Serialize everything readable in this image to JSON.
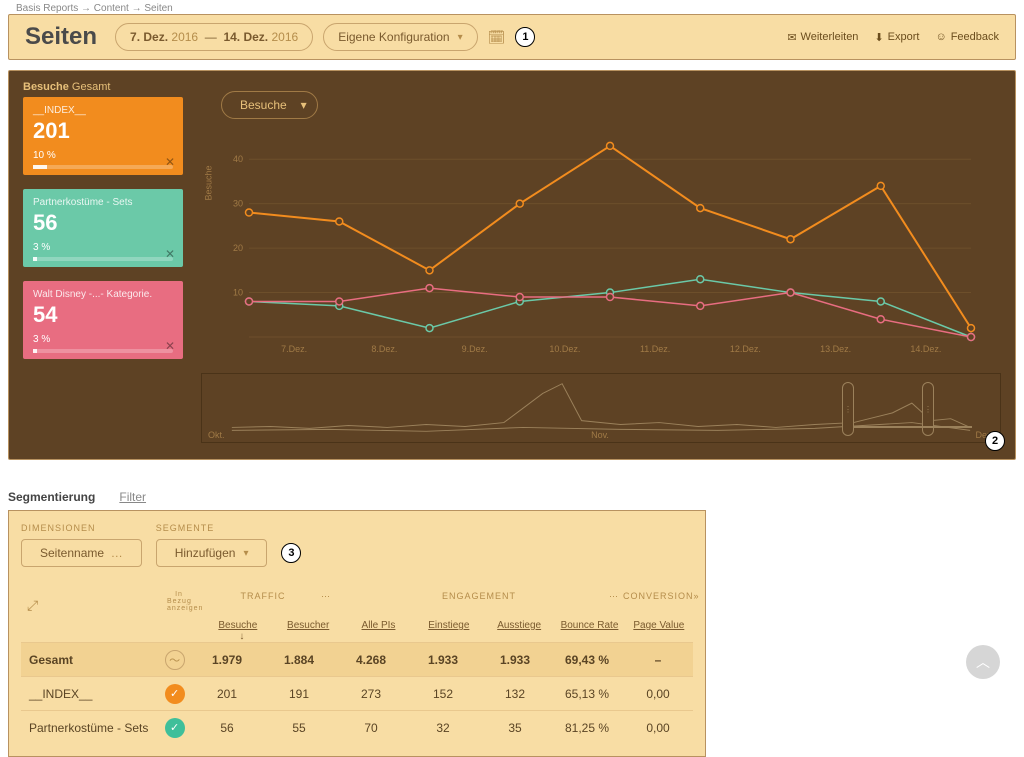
{
  "breadcrumb": "Basis Reports → Content → Seiten",
  "page_title": "Seiten",
  "date_range": {
    "from_day": "7. Dez.",
    "from_year": "2016",
    "sep": "—",
    "to_day": "14. Dez.",
    "to_year": "2016"
  },
  "config_dropdown": "Eigene Konfiguration",
  "annotations": {
    "a1": "1",
    "a2": "2",
    "a3": "3"
  },
  "actions": {
    "forward": "Weiterleiten",
    "export": "Export",
    "feedback": "Feedback"
  },
  "chart": {
    "panel_label_prefix": "Besuche",
    "panel_label_suffix": "Gesamt",
    "metric_dropdown": "Besuche",
    "ylabel": "Besuche",
    "cards": [
      {
        "name": "__INDEX__",
        "value": "201",
        "pct": "10 %",
        "pct_w": "10%",
        "cls": "c-orange"
      },
      {
        "name": "Partnerkostüme - Sets",
        "value": "56",
        "pct": "3 %",
        "pct_w": "3%",
        "cls": "c-teal"
      },
      {
        "name": "Walt Disney -...- Kategorie.",
        "value": "54",
        "pct": "3 %",
        "pct_w": "3%",
        "cls": "c-pink"
      }
    ],
    "mini_labels": {
      "l1": "Okt.",
      "l2": "Nov.",
      "l3": "Dez."
    }
  },
  "chart_data": {
    "type": "line",
    "categories": [
      "7.Dez.",
      "8.Dez.",
      "9.Dez.",
      "10.Dez.",
      "11.Dez.",
      "12.Dez.",
      "13.Dez.",
      "14.Dez."
    ],
    "series": [
      {
        "name": "__INDEX__",
        "color": "#f28c1e",
        "values": [
          28,
          26,
          15,
          30,
          43,
          29,
          22,
          34,
          2
        ]
      },
      {
        "name": "Partnerkostüme - Sets",
        "color": "#6bc9a8",
        "values": [
          8,
          7,
          2,
          8,
          10,
          13,
          10,
          8,
          0
        ]
      },
      {
        "name": "Walt Disney -...- Kategorie.",
        "color": "#e86d81",
        "values": [
          8,
          8,
          11,
          9,
          9,
          7,
          10,
          4,
          0
        ]
      }
    ],
    "ylabel": "Besuche",
    "ylim": [
      0,
      45
    ],
    "yticks": [
      10,
      20,
      30,
      40
    ],
    "xlabel": ""
  },
  "seg": {
    "tab_seg": "Segmentierung",
    "tab_filter": "Filter",
    "lbl_dim": "DIMENSIONEN",
    "lbl_seg": "SEGMENTE",
    "dim_value": "Seitenname",
    "add_label": "Hinzufügen",
    "groups": {
      "traffic": "TRAFFIC",
      "engagement": "ENGAGEMENT",
      "conversion": "CONVERSION"
    },
    "cols": {
      "besuche": "Besuche",
      "besucher": "Besucher",
      "allepis": "Alle PIs",
      "einstiege": "Einstiege",
      "ausstiege": "Ausstiege",
      "bounce": "Bounce Rate",
      "pagevalue": "Page Value"
    },
    "rows": [
      {
        "label": "Gesamt",
        "badge": "outline",
        "vals": [
          "1.979",
          "1.884",
          "4.268",
          "1.933",
          "1.933",
          "69,43 %",
          "–"
        ],
        "bold": true
      },
      {
        "label": "__INDEX__",
        "badge": "orange",
        "vals": [
          "201",
          "191",
          "273",
          "152",
          "132",
          "65,13 %",
          "0,00"
        ]
      },
      {
        "label": "Partnerkostüme - Sets",
        "badge": "teal",
        "vals": [
          "56",
          "55",
          "70",
          "32",
          "35",
          "81,25 %",
          "0,00"
        ]
      }
    ],
    "intable": "In Bezug\nanzeigen"
  }
}
